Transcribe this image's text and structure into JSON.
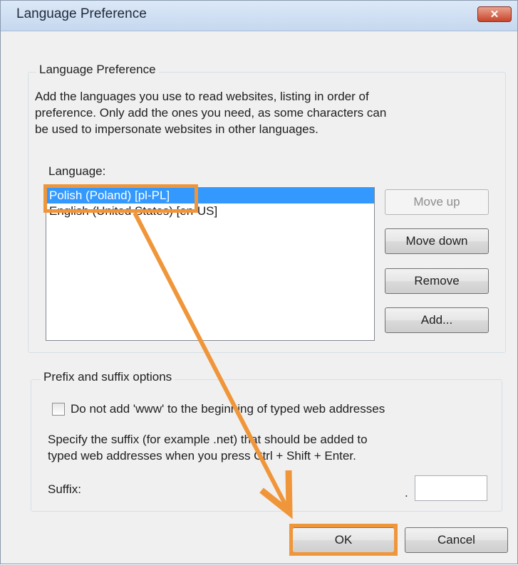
{
  "window": {
    "title": "Language Preference",
    "close_glyph": "✕"
  },
  "language_group": {
    "legend": "Language Preference",
    "description_lines": [
      "Add the languages you use to read websites, listing in order of",
      "preference. Only add the ones you need, as some characters can",
      "be used to impersonate websites in other languages."
    ],
    "list_label": "Language:",
    "languages": [
      "Polish (Poland) [pl-PL]",
      "English (United States) [en-US]"
    ],
    "selected_index": 0,
    "buttons": {
      "move_up": "Move up",
      "move_down": "Move down",
      "remove": "Remove",
      "add": "Add..."
    }
  },
  "suffix_group": {
    "legend": "Prefix and suffix options",
    "checkbox_label": "Do not add 'www' to the beginning of typed web addresses",
    "checkbox_checked": false,
    "description_lines": [
      "Specify the suffix (for example .net) that should be added to",
      "typed web addresses when you press Ctrl + Shift + Enter."
    ],
    "suffix_label": "Suffix:",
    "suffix_dot": ".",
    "suffix_value": ""
  },
  "footer": {
    "ok": "OK",
    "cancel": "Cancel"
  },
  "annotation": {
    "color": "#f0963a"
  }
}
